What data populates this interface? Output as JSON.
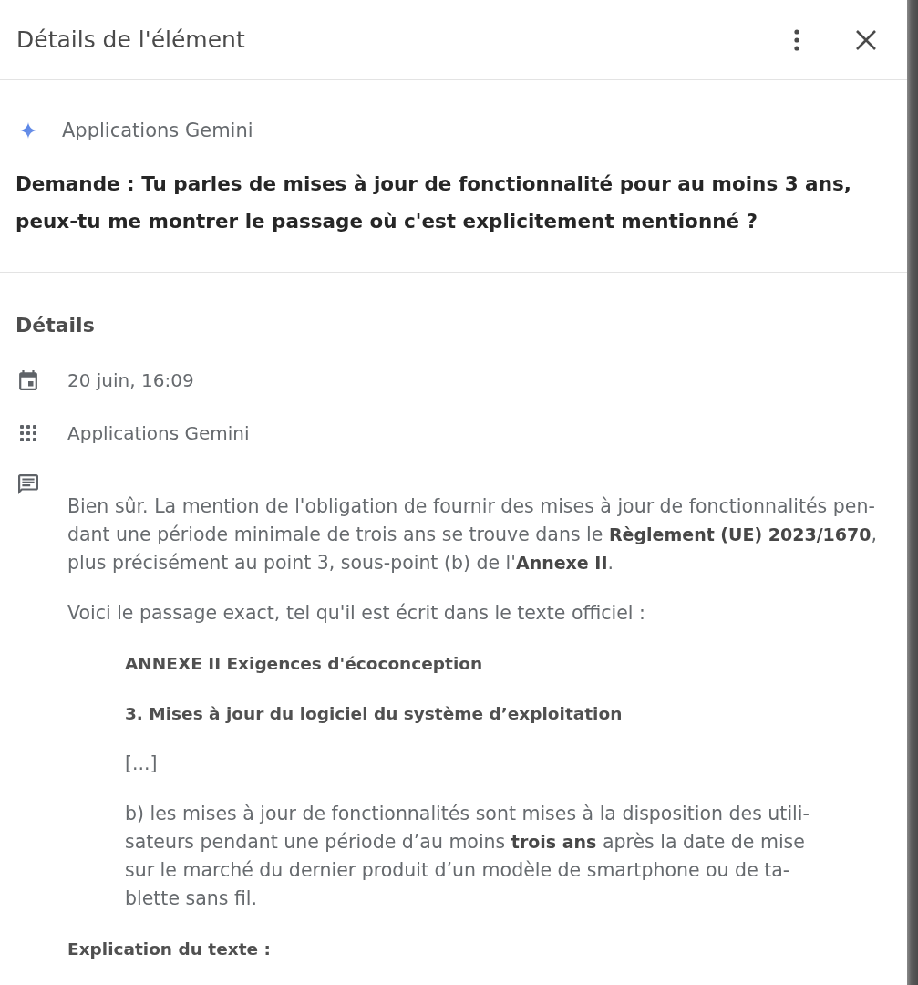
{
  "panel": {
    "title": "Détails de l'élément"
  },
  "source": {
    "app": "Applications Gemini"
  },
  "request": {
    "lines": [
      "Demande : Tu parles de mises à jour de fonctionnalité pour au moins 3 ans,",
      "peux-tu me montrer le passage où c'est explicitement mentionné ?"
    ]
  },
  "details": {
    "heading": "Détails",
    "rows": [
      {
        "kind": "date",
        "text": "20 juin, 16:09"
      },
      {
        "kind": "app",
        "text": "Applications Gemini"
      }
    ]
  },
  "response": {
    "blocks": [
      {
        "kind": "paragraph",
        "lines": [
          "Bien sûr. La mention de l'obligation de fournir des mises à jour de fonctionnalités pen-",
          "dant une période minimale de trois ans se trouve dans le **Règlement (UE) 2023/1670**,",
          "plus précisément au point 3, sous-point (b) de l'**Annexe II**."
        ]
      },
      {
        "kind": "paragraph",
        "lines": [
          "Voici le passage exact, tel qu'il est écrit dans le texte officiel :"
        ]
      },
      {
        "kind": "quote_heading",
        "lines": [
          "ANNEXE II Exigences d'écoconception"
        ]
      },
      {
        "kind": "quote_heading",
        "lines": [
          "3. Mises à jour du logiciel du système d’exploitation"
        ]
      },
      {
        "kind": "quote",
        "lines": [
          "[...]"
        ]
      },
      {
        "kind": "quote",
        "lines": [
          "b) les mises à jour de fonctionnalités sont mises à la disposition des utili-",
          "sateurs pendant une période d’au moins **trois ans** après la date de mise",
          "sur le marché du dernier produit d’un modèle de smartphone ou de ta-",
          "blette sans fil."
        ]
      },
      {
        "kind": "heading",
        "lines": [
          "Explication du texte :"
        ]
      }
    ]
  }
}
